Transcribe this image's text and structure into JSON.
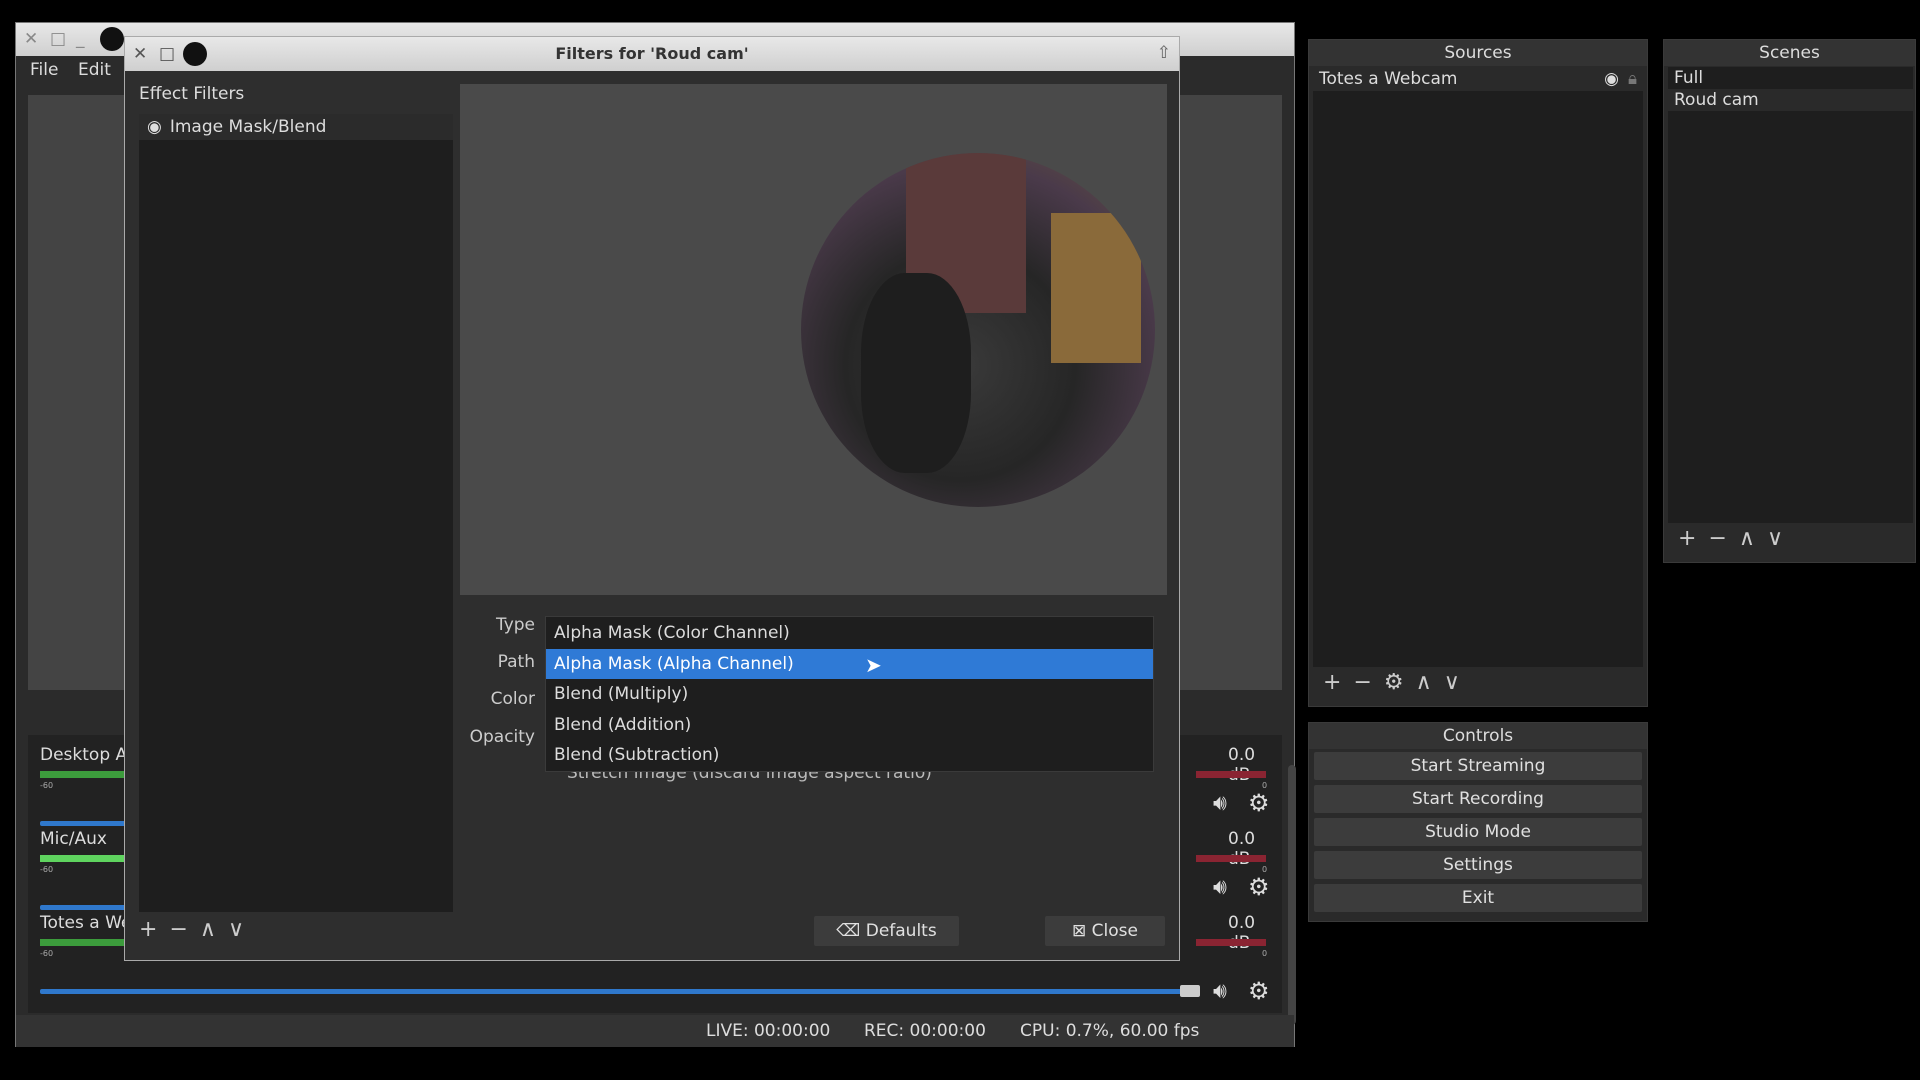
{
  "main_window": {
    "menu": [
      "File",
      "Edit"
    ]
  },
  "dialog": {
    "title": "Filters for 'Roud cam'",
    "effect_filters_label": "Effect Filters",
    "filters": [
      {
        "name": "Image Mask/Blend"
      }
    ],
    "labels": {
      "type": "Type",
      "path": "Path",
      "color": "Color",
      "opacity": "Opacity"
    },
    "type_options": [
      "Alpha Mask (Color Channel)",
      "Alpha Mask (Alpha Channel)",
      "Blend (Multiply)",
      "Blend (Addition)",
      "Blend (Subtraction)"
    ],
    "highlighted_option": "Alpha Mask (Alpha Channel)",
    "stretch_label": "Stretch image (discard image aspect ratio)",
    "defaults_button": "Defaults",
    "close_button": "Close"
  },
  "sources": {
    "title": "Sources",
    "items": [
      "Totes a Webcam"
    ]
  },
  "scenes": {
    "title": "Scenes",
    "items": [
      "Full",
      "Roud cam"
    ],
    "selected": "Roud cam"
  },
  "controls": {
    "title": "Controls",
    "buttons": [
      "Start Streaming",
      "Start Recording",
      "Studio Mode",
      "Settings",
      "Exit"
    ]
  },
  "mixer": {
    "channels": [
      {
        "name": "Desktop Au",
        "db": "0.0 dB"
      },
      {
        "name": "Mic/Aux",
        "db": "0.0 dB"
      },
      {
        "name": "Totes a Wel",
        "db": "0.0 dB"
      }
    ],
    "scale_min": "-60",
    "scale_max": "0"
  },
  "status": {
    "live": "LIVE: 00:00:00",
    "rec": "REC: 00:00:00",
    "cpu": "CPU: 0.7%, 60.00 fps"
  },
  "colors": {
    "highlight": "#2f7ad6",
    "background": "#2b2b2b"
  }
}
